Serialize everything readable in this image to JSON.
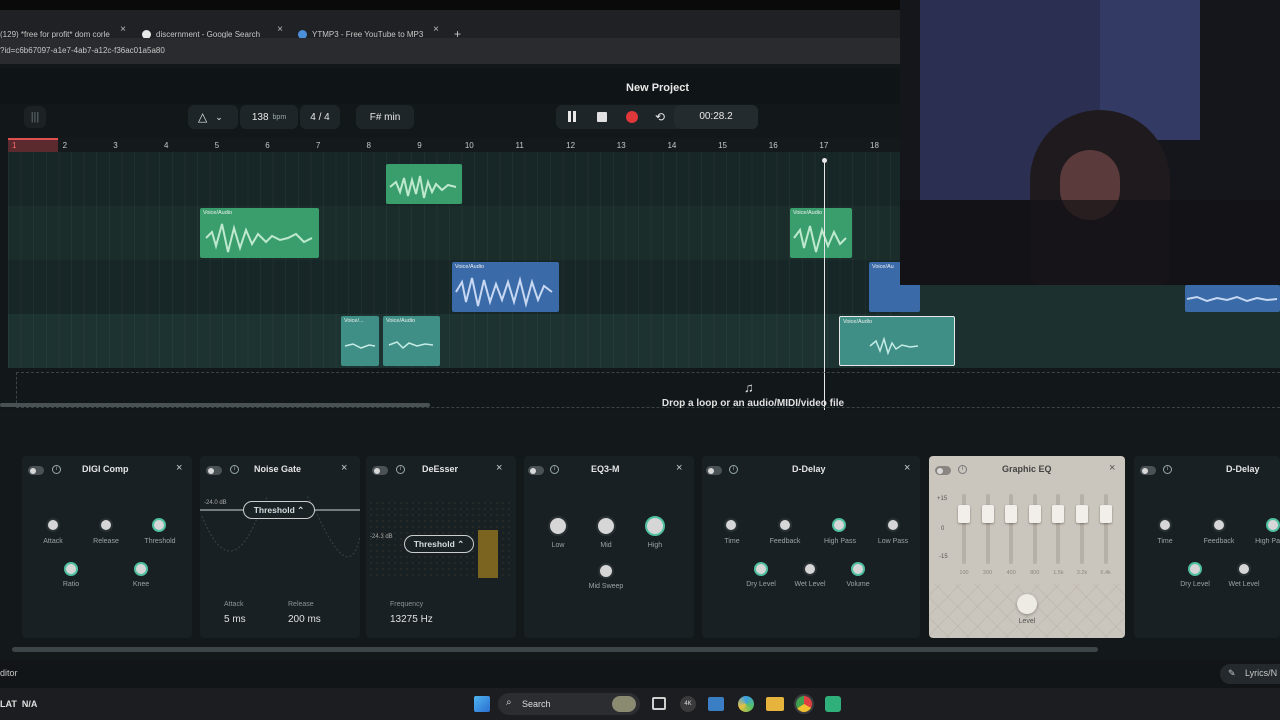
{
  "browser": {
    "tabs": [
      {
        "label": "(129) *free for profit* dom corle",
        "close": "×"
      },
      {
        "label": "discernment - Google Search",
        "close": "×"
      },
      {
        "label": "YTMP3 - Free YouTube to MP3",
        "close": "×"
      }
    ],
    "new_tab": "+",
    "url": "?id=c6b67097-a1e7-4ab7-a12c-f36ac01a5a80"
  },
  "project": {
    "title": "New Project",
    "bpm_value": "138",
    "bpm_unit": "bpm",
    "time_sig": "4 / 4",
    "key": "F# min",
    "time": "00:28.2"
  },
  "ruler": [
    "1",
    "2",
    "3",
    "4",
    "5",
    "6",
    "7",
    "8",
    "9",
    "10",
    "11",
    "12",
    "13",
    "14",
    "15",
    "16",
    "17",
    "18"
  ],
  "clips": [
    {
      "label": ""
    },
    {
      "label": "Voice/Audio"
    },
    {
      "label": "Voice/Audio"
    },
    {
      "label": "Voice/Audio"
    },
    {
      "label": "Voice/Au"
    },
    {
      "label": "Voice/..."
    },
    {
      "label": "Voice/Audio"
    },
    {
      "label": "Voice/Audio"
    }
  ],
  "drop_hint": "Drop a loop or an audio/MIDI/video file",
  "effects": {
    "digi_comp": {
      "title": "DIGI Comp",
      "knobs": [
        "Attack",
        "Release",
        "Threshold",
        "Ratio",
        "Knee"
      ]
    },
    "noise_gate": {
      "title": "Noise Gate",
      "db": "-24.0 dB",
      "threshold": "Threshold",
      "attack_label": "Attack",
      "attack_value": "5 ms",
      "release_label": "Release",
      "release_value": "200 ms"
    },
    "deesser": {
      "title": "DeEsser",
      "db": "-24.3 dB",
      "threshold": "Threshold",
      "freq_label": "Frequency",
      "freq_value": "13275 Hz"
    },
    "eq3m": {
      "title": "EQ3-M",
      "knobs": [
        "Low",
        "Mid",
        "High",
        "Mid Sweep"
      ]
    },
    "ddelay": {
      "title": "D-Delay",
      "knobs": [
        "Time",
        "Feedback",
        "High Pass",
        "Low Pass",
        "Dry Level",
        "Wet Level",
        "Volume"
      ]
    },
    "graphic_eq": {
      "title": "Graphic EQ",
      "scale": [
        "+15",
        "0",
        "-15"
      ],
      "bands": [
        "100",
        "200",
        "400",
        "800",
        "1.5k",
        "3.2k",
        "6.4k"
      ],
      "level": "Level"
    },
    "ddelay2": {
      "title": "D-Delay",
      "knobs": [
        "Time",
        "Feedback",
        "High Pa",
        "Dry Level",
        "Wet Level"
      ]
    }
  },
  "status": {
    "left": "ditor",
    "right": "Lyrics/N"
  },
  "taskbar": {
    "left": "LAT  N/A",
    "search": "Search"
  },
  "colors": {
    "green_clip": "#3a9e6c",
    "blue_clip": "#3a6aa8",
    "teal_clip": "#3f8f86",
    "accent": "#4fbfa0"
  }
}
